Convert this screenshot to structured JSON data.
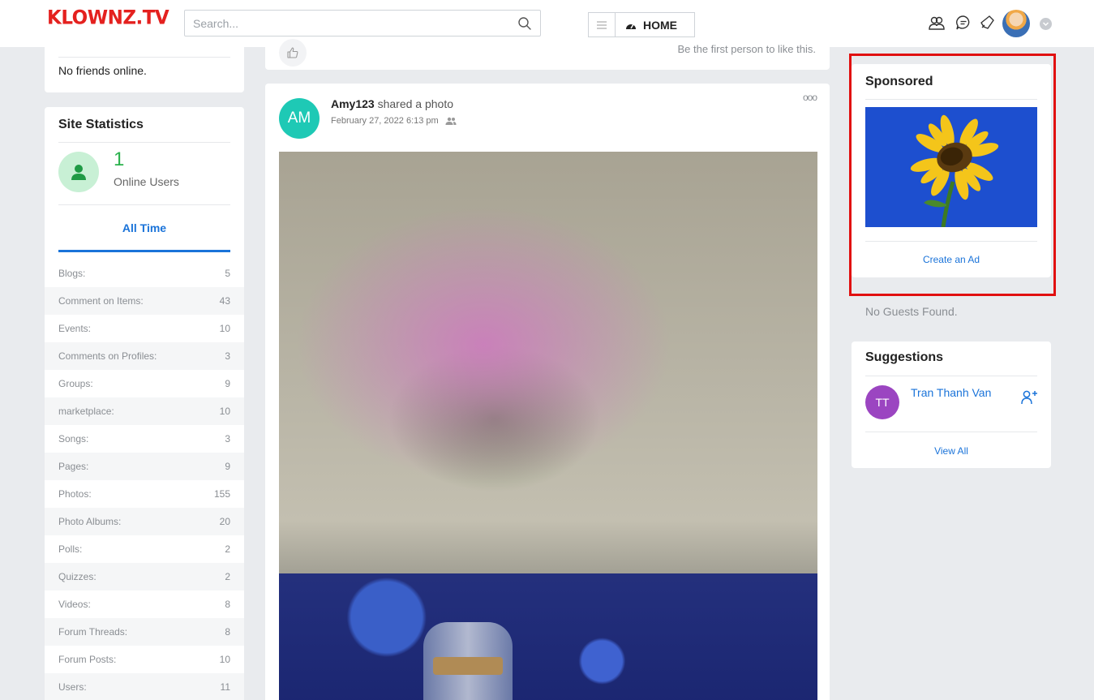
{
  "header": {
    "logo": "KLOWNZ.TV",
    "search_placeholder": "Search...",
    "home_label": "HOME"
  },
  "left": {
    "friends_status": "No friends online.",
    "stats_title": "Site Statistics",
    "online_count": "1",
    "online_label": "Online Users",
    "tab_label": "All Time",
    "stats": [
      {
        "label": "Blogs:",
        "value": "5"
      },
      {
        "label": "Comment on Items:",
        "value": "43"
      },
      {
        "label": "Events:",
        "value": "10"
      },
      {
        "label": "Comments on Profiles:",
        "value": "3"
      },
      {
        "label": "Groups:",
        "value": "9"
      },
      {
        "label": "marketplace:",
        "value": "10"
      },
      {
        "label": "Songs:",
        "value": "3"
      },
      {
        "label": "Pages:",
        "value": "9"
      },
      {
        "label": "Photos:",
        "value": "155"
      },
      {
        "label": "Photo Albums:",
        "value": "20"
      },
      {
        "label": "Polls:",
        "value": "2"
      },
      {
        "label": "Quizzes:",
        "value": "2"
      },
      {
        "label": "Videos:",
        "value": "8"
      },
      {
        "label": "Forum Threads:",
        "value": "8"
      },
      {
        "label": "Forum Posts:",
        "value": "10"
      },
      {
        "label": "Users:",
        "value": "11"
      }
    ]
  },
  "feed": {
    "like_prompt": "Be the first person to like this.",
    "post": {
      "avatar_initials": "AM",
      "author": "Amy123",
      "action": "shared a photo",
      "date": "February 27, 2022 6:13 pm",
      "more_icon": "ooo"
    }
  },
  "right": {
    "sponsored_title": "Sponsored",
    "create_ad": "Create an Ad",
    "no_guests": "No Guests Found.",
    "suggestions_title": "Suggestions",
    "suggestion": {
      "initials": "TT",
      "name": "Tran Thanh Van"
    },
    "view_all": "View All"
  },
  "colors": {
    "logo": "#e4211f",
    "link": "#1a73d9",
    "online": "#2bb14d",
    "highlight_frame": "#e11010",
    "post_avatar": "#1ec9b5",
    "suggestion_avatar": "#9b45c1"
  }
}
